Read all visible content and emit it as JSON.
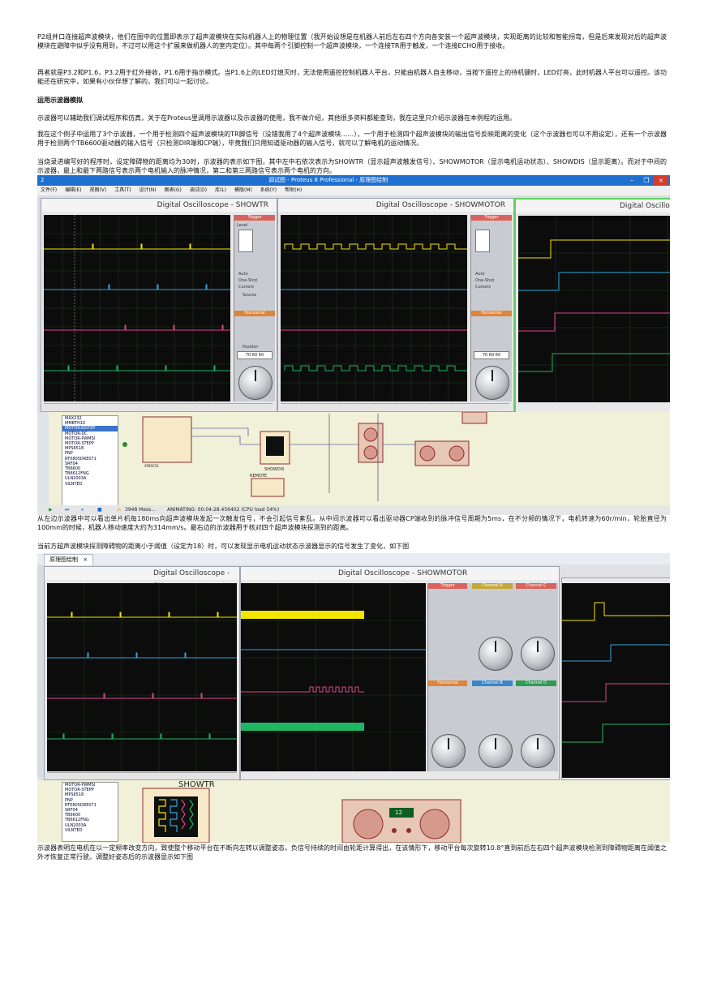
{
  "paragraphs": {
    "p1": "P2组并口连接超声波模块，他们在图中的位置即表示了超声波模块在实际机器人上的物理位置（我开始设想是在机器人前后左右四个方向各安装一个超声波模块，实现距离的比较和智能拐弯，但是后来发现对后的超声波模块在避障中似乎没有用到，不过可以用这个扩展来做机器人的室内定位）。其中每两个引脚控制一个超声波模块，一个连接TR用于触发，一个连接ECHO用于接收。",
    "p2": "再者就是P3.2和P1.6，P3.2用于红外接收，P1.6用于指示模式。当P1.6上的LED灯熄灭时，无法使用遥控控制机器人平台，只能由机器人自主移动，当按下遥控上的待机键时，LED灯亮，此时机器人平台可以遥控。该功能还在研究中，如果有小伙伴想了解的，我们可以一起讨论。",
    "h1": "运用示波器模拟",
    "p3": "示波器可以辅助我们调试程序和仿真，关于在Proteus里调用示波器以及示波器的使用，我不做介绍，其他很多资料都能查到，我在这里只介绍示波器在本例程的运用。",
    "p4": "我在这个例子中运用了3个示波器，一个用于检测四个超声波模块的TR脚信号（没错我用了4个超声波模块……），一个用于检测四个超声波模块的输出信号反映距离的变化（这个示波器也可以不用设定），还有一个示波器用于检测两个TB6600驱动器的输入信号（只检测DIR端和CP端），毕竟我们只用知道驱动器的输入信号，就可以了解电机的运动情况。",
    "p5": "当烧录进编写好的程序时，设定障碍物的距离均为30时，示波器的表示如下图，其中左中右依次表示为SHOWTR（显示超声波触发信号）、SHOWMOTOR（显示电机运动状态）、SHOWDIS（显示距离）。而对于中间的示波器，最上和最下两路信号表示两个电机输入的脉冲情况，第二和第三两路信号表示两个电机的方向。",
    "p6": "从左边示波器中可以看出单片机每180ms向超声波模块发起一次触发信号，不会引起信号紊乱。从中间示波器可以看出驱动器CP端收到的脉冲信号周期为5ms，在不分频的情况下，电机转速为60r/min，轮胎直径为100mm的时候，机器人移动速度大约为314mm/s。最右边的示波器用于核对四个超声波模块探测到的距离。",
    "p7": "当前方超声波模块探测障碍物的距离小于阈值（设定为18）时，可以发现显示电机运动状态示波器显示的信号发生了变化，如下图",
    "p8": "示波器表明左电机在以一定频率改变方向，致使整个移动平台在不断向左转以调整姿态，负信号持续的时间由轮距计算得出，在该情形下，移动平台每次旋转10.8°直到前后左右四个超声波模块检测到障碍物距离在阈值之外才恢复正常行驶。调整好姿态后的示波器显示如下图"
  },
  "shot1": {
    "window_number": "2",
    "window_title": "调试图 - Proteus 8 Professional - 原理图绘制",
    "win_min": "–",
    "win_max": "❐",
    "win_close": "×",
    "menu": [
      "文件(F)",
      "编辑(E)",
      "视图(V)",
      "工具(T)",
      "设计(N)",
      "图表(G)",
      "调试(D)",
      "库(L)",
      "模版(M)",
      "系统(Y)",
      "帮助(H)"
    ],
    "osc_titles": [
      "Digital Oscilloscope - SHOWTR",
      "Digital Oscilloscope - SHOWMOTOR",
      "Digital Oscillo"
    ],
    "panel_trigger": "Trigger",
    "panel_horizontal": "Horizontal",
    "panel_source": "Source",
    "panel_position": "Position",
    "panel_level": "Level",
    "panel_auto": "Auto",
    "panel_oneshot": "One-Shot",
    "panel_cursors": "Cursors",
    "panel_pos_values": "70 60 60",
    "components": [
      "MAX232",
      "MMBTH10",
      "MOTOR-BISTEP",
      "MOTOR-DC",
      "MOTOR-PWMSI",
      "MOTOR-STEPP",
      "MPS6518",
      "PNP",
      "RT0805DRE071",
      "SRF04",
      "TB6600",
      "TB6612FNG",
      "ULN2003A",
      "VILNTED"
    ],
    "selected_component": "MOTOR-BISTEP",
    "schem_labels": {
      "showdis": "SHOWDIS",
      "remote": "REMOTE",
      "mcu": "AT89C52"
    },
    "status_msgs": "3948 Mess...",
    "status_anim": "ANIMATING: 00:04:28.456402 (CPU load 54%)"
  },
  "shot2": {
    "tab_label": "原理图绘制",
    "osc_titles": [
      "Digital Oscilloscope - SH",
      "Digital Oscilloscope - SHOWMOTOR"
    ],
    "channels": [
      "Trigger",
      "Channel A",
      "Channel C",
      "Channel B",
      "Channel D"
    ],
    "horizontal": "Horizontal",
    "schem_label": "SHOWTR",
    "display_value": "12",
    "components": [
      "MOTOR-PWMSI",
      "MOTOR-STEPP",
      "MPS6518",
      "PNP",
      "RT0805DRE071",
      "SRF04",
      "TB6600",
      "TB6612FNG",
      "ULN2003A",
      "VILNTED"
    ]
  },
  "colors": {
    "ch_yellow": "#f2e600",
    "ch_cyan": "#2fa6d8",
    "ch_pink": "#e0438a",
    "ch_green": "#1fb564"
  }
}
